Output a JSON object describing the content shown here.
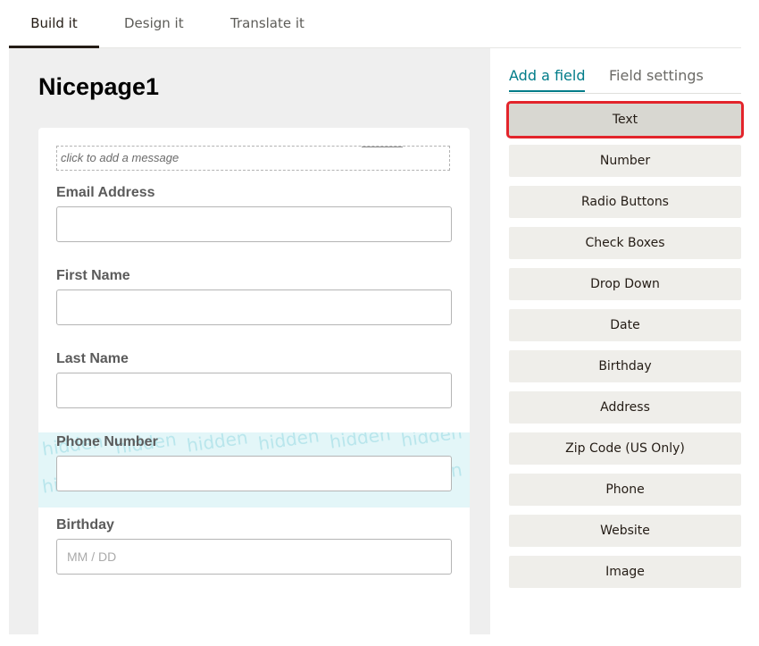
{
  "top_tabs": [
    {
      "label": "Build it",
      "active": true
    },
    {
      "label": "Design it",
      "active": false
    },
    {
      "label": "Translate it",
      "active": false
    }
  ],
  "form": {
    "title": "Nicepage1",
    "message_placeholder": "click to add a message",
    "fields": [
      {
        "label": "Email Address",
        "placeholder": ""
      },
      {
        "label": "First Name",
        "placeholder": ""
      },
      {
        "label": "Last Name",
        "placeholder": ""
      },
      {
        "label": "Phone Number",
        "placeholder": "",
        "hidden": true
      },
      {
        "label": "Birthday",
        "placeholder": "MM / DD"
      }
    ],
    "hidden_watermark": "hidden"
  },
  "right_panel": {
    "tabs": [
      {
        "label": "Add a field",
        "active": true
      },
      {
        "label": "Field settings",
        "active": false
      }
    ],
    "field_types": [
      "Text",
      "Number",
      "Radio Buttons",
      "Check Boxes",
      "Drop Down",
      "Date",
      "Birthday",
      "Address",
      "Zip Code (US Only)",
      "Phone",
      "Website",
      "Image"
    ],
    "selected_field_type": "Text"
  },
  "colors": {
    "accent": "#007c89",
    "highlight": "#e3242b",
    "hidden_band": "#e3f6f8"
  }
}
